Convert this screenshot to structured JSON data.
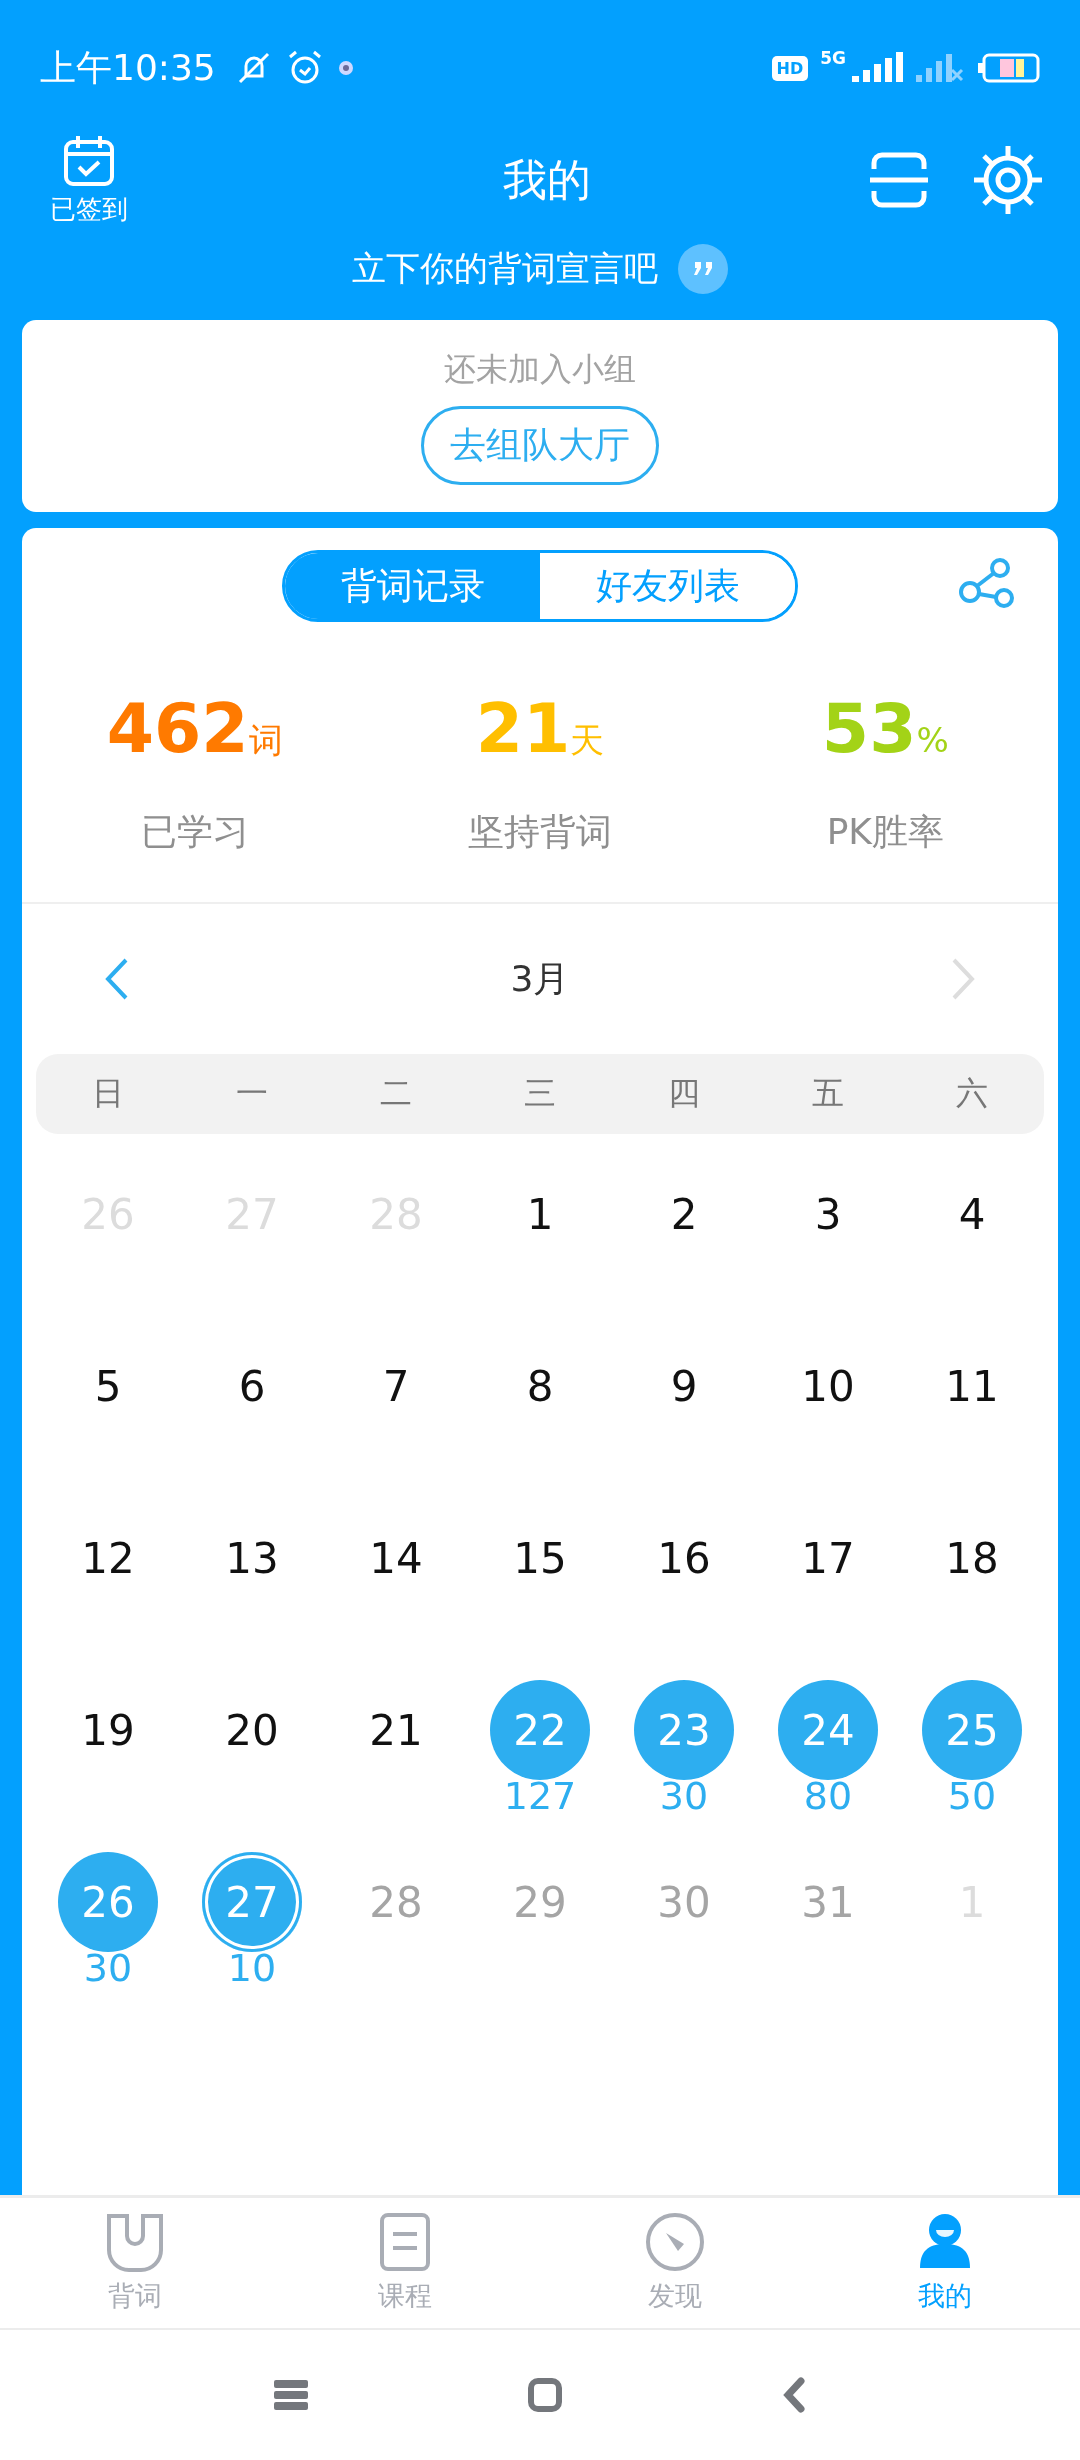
{
  "status_bar": {
    "time": "上午10:35",
    "network": "5G",
    "hd": "HD"
  },
  "header": {
    "checkin_label": "已签到",
    "title": "我的"
  },
  "slogan": "立下你的背词宣言吧",
  "group_card": {
    "message": "还未加入小组",
    "button": "去组队大厅"
  },
  "tabs": [
    {
      "label": "背词记录",
      "selected": true
    },
    {
      "label": "好友列表",
      "selected": false
    }
  ],
  "stats": [
    {
      "value": "462",
      "unit": "词",
      "label": "已学习",
      "color": "#ff7a00"
    },
    {
      "value": "21",
      "unit": "天",
      "label": "坚持背词",
      "color": "#ffbf00"
    },
    {
      "value": "53",
      "unit": "%",
      "label": "PK胜率",
      "color": "#a3d317"
    }
  ],
  "calendar": {
    "month": "3月",
    "prev_enabled": true,
    "next_enabled": false,
    "weekdays": [
      "日",
      "一",
      "二",
      "三",
      "四",
      "五",
      "六"
    ],
    "days": [
      {
        "day": "26",
        "kind": "outside",
        "today": false
      },
      {
        "day": "27",
        "kind": "outside",
        "today": false
      },
      {
        "day": "28",
        "kind": "outside",
        "today": false
      },
      {
        "day": "1",
        "kind": "normal",
        "today": false
      },
      {
        "day": "2",
        "kind": "normal",
        "today": false
      },
      {
        "day": "3",
        "kind": "normal",
        "today": false
      },
      {
        "day": "4",
        "kind": "normal",
        "today": false
      },
      {
        "day": "5",
        "kind": "normal",
        "today": false
      },
      {
        "day": "6",
        "kind": "normal",
        "today": false
      },
      {
        "day": "7",
        "kind": "normal",
        "today": false
      },
      {
        "day": "8",
        "kind": "normal",
        "today": false
      },
      {
        "day": "9",
        "kind": "normal",
        "today": false
      },
      {
        "day": "10",
        "kind": "normal",
        "today": false
      },
      {
        "day": "11",
        "kind": "normal",
        "today": false
      },
      {
        "day": "12",
        "kind": "normal",
        "today": false
      },
      {
        "day": "13",
        "kind": "normal",
        "today": false
      },
      {
        "day": "14",
        "kind": "normal",
        "today": false
      },
      {
        "day": "15",
        "kind": "normal",
        "today": false
      },
      {
        "day": "16",
        "kind": "normal",
        "today": false
      },
      {
        "day": "17",
        "kind": "normal",
        "today": false
      },
      {
        "day": "18",
        "kind": "normal",
        "today": false
      },
      {
        "day": "19",
        "kind": "normal",
        "today": false
      },
      {
        "day": "20",
        "kind": "normal",
        "today": false
      },
      {
        "day": "21",
        "kind": "normal",
        "today": false
      },
      {
        "day": "22",
        "kind": "studied",
        "count": "127",
        "today": false
      },
      {
        "day": "23",
        "kind": "studied",
        "count": "30",
        "today": false
      },
      {
        "day": "24",
        "kind": "studied",
        "count": "80",
        "today": false
      },
      {
        "day": "25",
        "kind": "studied",
        "count": "50",
        "today": false
      },
      {
        "day": "26",
        "kind": "studied",
        "count": "30",
        "today": false
      },
      {
        "day": "27",
        "kind": "studied",
        "count": "10",
        "today": true
      },
      {
        "day": "28",
        "kind": "future",
        "today": false
      },
      {
        "day": "29",
        "kind": "future",
        "today": false
      },
      {
        "day": "30",
        "kind": "future",
        "today": false
      },
      {
        "day": "31",
        "kind": "future",
        "today": false
      },
      {
        "day": "1",
        "kind": "outside",
        "today": false
      }
    ]
  },
  "bottom_nav": [
    {
      "label": "背词",
      "kind": "words",
      "selected": false
    },
    {
      "label": "课程",
      "kind": "course",
      "selected": false
    },
    {
      "label": "发现",
      "kind": "discover",
      "selected": false
    },
    {
      "label": "我的",
      "kind": "me",
      "selected": true
    }
  ]
}
